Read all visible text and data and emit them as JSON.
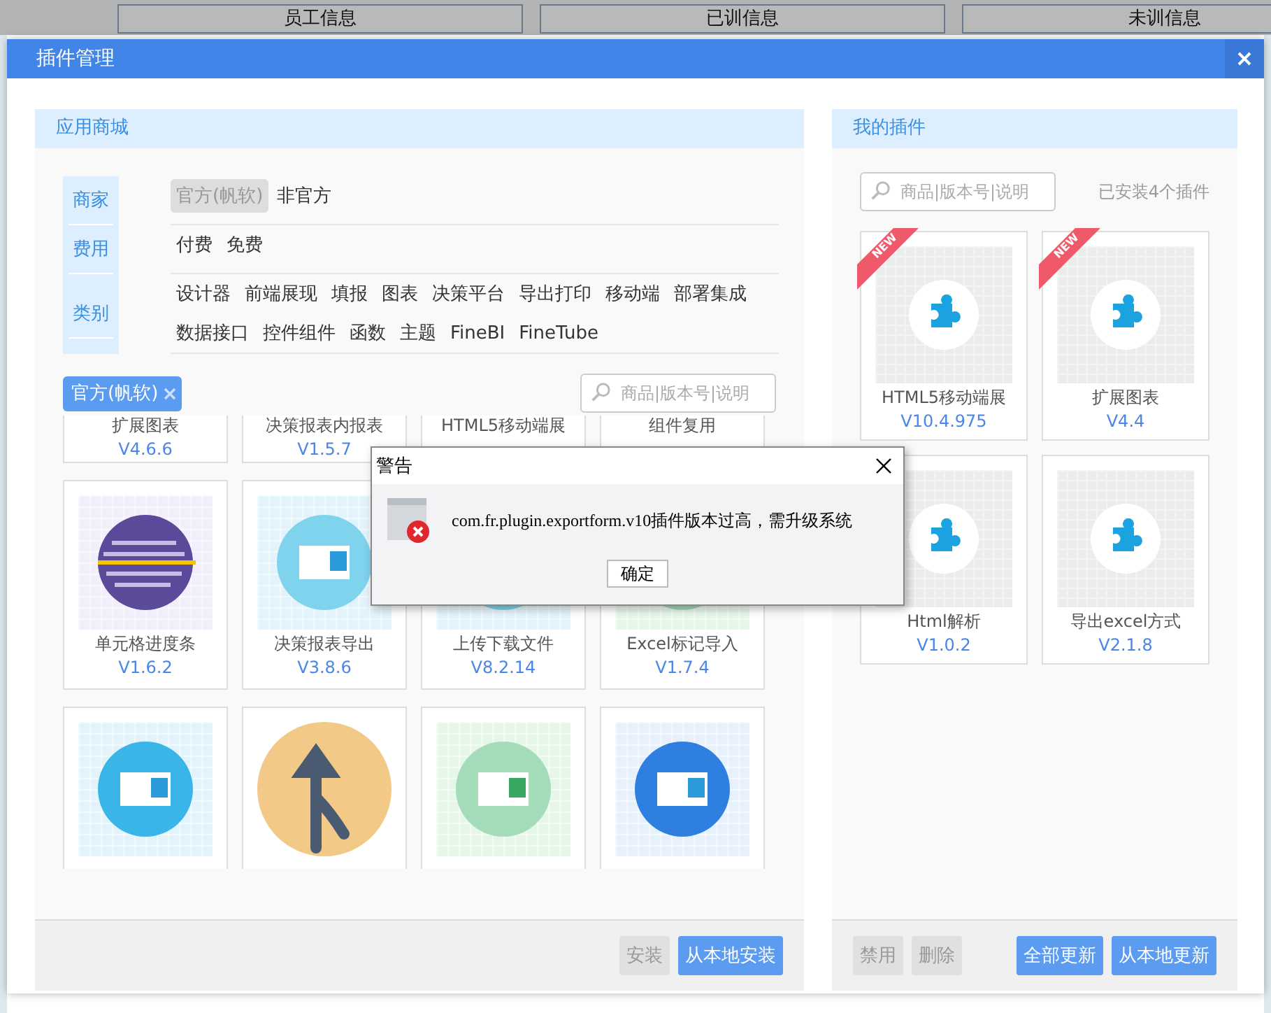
{
  "background": {
    "tabs": [
      {
        "label": "员工信息"
      },
      {
        "label": "已训信息"
      },
      {
        "label": "未训信息"
      }
    ]
  },
  "window": {
    "title": "插件管理"
  },
  "store": {
    "title": "应用商城",
    "filters": [
      {
        "label": "商家",
        "options": [
          {
            "label": "官方(帆软)",
            "selected": true
          },
          {
            "label": "非官方",
            "selected": false
          }
        ]
      },
      {
        "label": "费用",
        "options": [
          {
            "label": "付费",
            "selected": false
          },
          {
            "label": "免费",
            "selected": false
          }
        ]
      },
      {
        "label": "类别",
        "options": [
          {
            "label": "设计器",
            "selected": false
          },
          {
            "label": "前端展现",
            "selected": false
          },
          {
            "label": "填报",
            "selected": false
          },
          {
            "label": "图表",
            "selected": false
          },
          {
            "label": "决策平台",
            "selected": false
          },
          {
            "label": "导出打印",
            "selected": false
          },
          {
            "label": "移动端",
            "selected": false
          },
          {
            "label": "部署集成",
            "selected": false
          },
          {
            "label": "数据接口",
            "selected": false
          },
          {
            "label": "控件组件",
            "selected": false
          },
          {
            "label": "函数",
            "selected": false
          },
          {
            "label": "主题",
            "selected": false
          },
          {
            "label": "FineBI",
            "selected": false
          },
          {
            "label": "FineTube",
            "selected": false
          }
        ]
      }
    ],
    "active_filter": "官方(帆软)",
    "search": {
      "placeholder": "商品|版本号|说明"
    },
    "plugins": [
      {
        "kind": "caption",
        "name": "扩展图表",
        "version": "V4.6.6"
      },
      {
        "kind": "caption",
        "name": "决策报表内报表",
        "version": "V1.5.7"
      },
      {
        "kind": "caption",
        "name": "HTML5移动端展"
      },
      {
        "kind": "caption",
        "name": "组件复用"
      },
      {
        "kind": "full",
        "name": "单元格进度条",
        "version": "V1.6.2"
      },
      {
        "kind": "full",
        "name": "决策报表导出",
        "version": "V3.8.6"
      },
      {
        "kind": "full",
        "name": "上传下载文件",
        "version": "V8.2.14"
      },
      {
        "kind": "full",
        "name": "Excel标记导入",
        "version": "V1.7.4"
      },
      {
        "kind": "image"
      },
      {
        "kind": "image"
      },
      {
        "kind": "image"
      },
      {
        "kind": "image"
      }
    ],
    "buttons": [
      {
        "label": "安装",
        "disabled": true
      },
      {
        "label": "从本地安装",
        "disabled": false
      }
    ]
  },
  "mine": {
    "title": "我的插件",
    "search": {
      "placeholder": "商品|版本号|说明"
    },
    "installed": "已安装4个插件",
    "plugins": [
      {
        "name": "HTML5移动端展",
        "version": "V10.4.975",
        "badge": "NEW"
      },
      {
        "name": "扩展图表",
        "version": "V4.4",
        "badge": "NEW"
      },
      {
        "name": "Html解析",
        "version": "V1.0.2"
      },
      {
        "name": "导出excel方式",
        "version": "V2.1.8"
      }
    ],
    "buttons": [
      {
        "label": "禁用",
        "disabled": true
      },
      {
        "label": "删除",
        "disabled": true
      },
      {
        "label": "全部更新",
        "disabled": false
      },
      {
        "label": "从本地更新",
        "disabled": false
      }
    ]
  },
  "alert": {
    "title": "警告",
    "message": "com.fr.plugin.exportform.v10插件版本过高，需升级系统",
    "button": "确定"
  }
}
